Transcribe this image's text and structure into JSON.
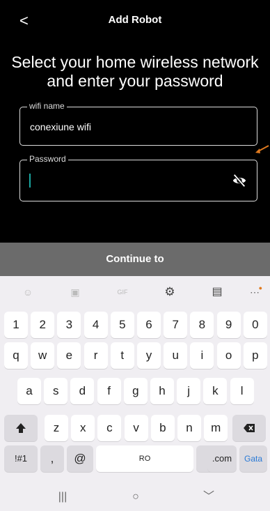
{
  "header": {
    "back_glyph": "<",
    "title": "Add Robot"
  },
  "heading": "Select your home wireless network and enter your password",
  "wifi_field": {
    "label": "wifi name",
    "value": "conexiune wifi"
  },
  "password_field": {
    "label": "Password",
    "value": ""
  },
  "continue_label": "Continue to",
  "keyboard": {
    "toolbar": [
      "emoji-icon",
      "sticker-icon",
      "gif-icon",
      "gear-icon",
      "clipboard-icon",
      "more-icon"
    ],
    "gif_label": "GIF",
    "number_row": [
      "1",
      "2",
      "3",
      "4",
      "5",
      "6",
      "7",
      "8",
      "9",
      "0"
    ],
    "row1": [
      "q",
      "w",
      "e",
      "r",
      "t",
      "y",
      "u",
      "i",
      "o",
      "p"
    ],
    "row2": [
      "a",
      "s",
      "d",
      "f",
      "g",
      "h",
      "j",
      "k",
      "l"
    ],
    "row3": [
      "z",
      "x",
      "c",
      "v",
      "b",
      "n",
      "m"
    ],
    "bottom": {
      "symbols": "!#1",
      "comma": ",",
      "at": "@",
      "space": "RO",
      "period": ".",
      "dotcom": ".com",
      "go": "Gata"
    }
  },
  "colors": {
    "accent": "#e07a1f",
    "caret": "#1aa6a0",
    "go_key": "#2a7ad6"
  }
}
